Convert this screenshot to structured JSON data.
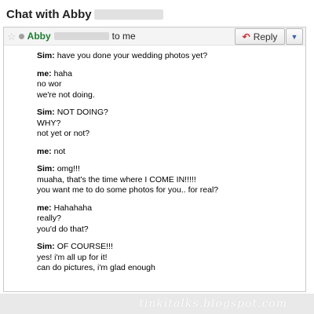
{
  "window": {
    "title": "Chat with Abby"
  },
  "header": {
    "sender": "Abby",
    "recipient": "to me",
    "reply_label": "Reply",
    "icons": {
      "star": "star-icon",
      "status": "status-dot-icon",
      "reply": "reply-arrow-icon",
      "more": "dropdown-arrow-icon"
    }
  },
  "messages": [
    {
      "speaker": "Sim:",
      "lines": [
        "have you done your wedding photos yet?"
      ]
    },
    {
      "speaker": "me:",
      "lines": [
        "haha",
        "no wor",
        "we're not doing."
      ]
    },
    {
      "speaker": "Sim:",
      "lines": [
        "NOT DOING?",
        "WHY?",
        "not yet or not?"
      ]
    },
    {
      "speaker": "me:",
      "lines": [
        "not"
      ]
    },
    {
      "speaker": "Sim:",
      "lines": [
        "omg!!!",
        "muaha, that's the time where I COME IN!!!!!",
        "you want me to do some photos for you.. for real?"
      ]
    },
    {
      "speaker": "me:",
      "lines": [
        "Hahahaha",
        "really?",
        "you'd do that?"
      ]
    },
    {
      "speaker": "Sim:",
      "lines": [
        "OF COURSE!!!",
        "yes!  i'm all up for it!",
        "can do pictures, i'm glad enough"
      ]
    }
  ],
  "watermark": "tinkitalks.blogspot.com",
  "colors": {
    "sender": "#1c7c2f",
    "reply_icon": "#d0313b",
    "border": "#c9c9c9"
  }
}
